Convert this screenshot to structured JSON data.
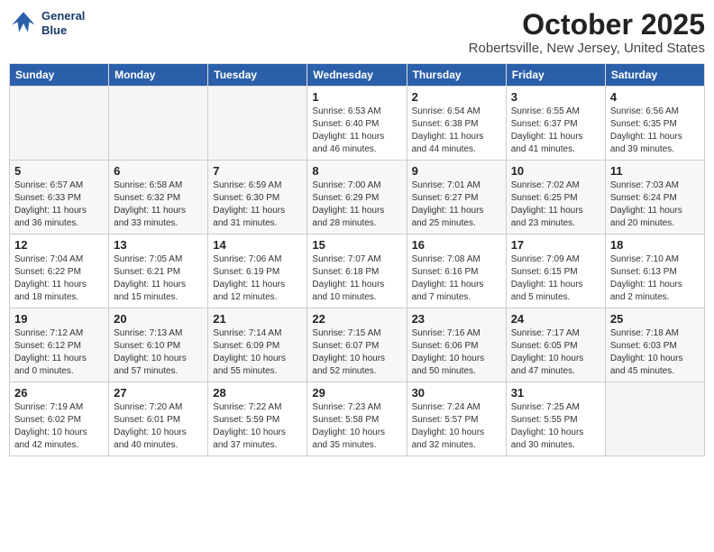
{
  "header": {
    "logo_line1": "General",
    "logo_line2": "Blue",
    "month": "October 2025",
    "location": "Robertsville, New Jersey, United States"
  },
  "weekdays": [
    "Sunday",
    "Monday",
    "Tuesday",
    "Wednesday",
    "Thursday",
    "Friday",
    "Saturday"
  ],
  "weeks": [
    [
      {
        "day": "",
        "info": ""
      },
      {
        "day": "",
        "info": ""
      },
      {
        "day": "",
        "info": ""
      },
      {
        "day": "1",
        "info": "Sunrise: 6:53 AM\nSunset: 6:40 PM\nDaylight: 11 hours\nand 46 minutes."
      },
      {
        "day": "2",
        "info": "Sunrise: 6:54 AM\nSunset: 6:38 PM\nDaylight: 11 hours\nand 44 minutes."
      },
      {
        "day": "3",
        "info": "Sunrise: 6:55 AM\nSunset: 6:37 PM\nDaylight: 11 hours\nand 41 minutes."
      },
      {
        "day": "4",
        "info": "Sunrise: 6:56 AM\nSunset: 6:35 PM\nDaylight: 11 hours\nand 39 minutes."
      }
    ],
    [
      {
        "day": "5",
        "info": "Sunrise: 6:57 AM\nSunset: 6:33 PM\nDaylight: 11 hours\nand 36 minutes."
      },
      {
        "day": "6",
        "info": "Sunrise: 6:58 AM\nSunset: 6:32 PM\nDaylight: 11 hours\nand 33 minutes."
      },
      {
        "day": "7",
        "info": "Sunrise: 6:59 AM\nSunset: 6:30 PM\nDaylight: 11 hours\nand 31 minutes."
      },
      {
        "day": "8",
        "info": "Sunrise: 7:00 AM\nSunset: 6:29 PM\nDaylight: 11 hours\nand 28 minutes."
      },
      {
        "day": "9",
        "info": "Sunrise: 7:01 AM\nSunset: 6:27 PM\nDaylight: 11 hours\nand 25 minutes."
      },
      {
        "day": "10",
        "info": "Sunrise: 7:02 AM\nSunset: 6:25 PM\nDaylight: 11 hours\nand 23 minutes."
      },
      {
        "day": "11",
        "info": "Sunrise: 7:03 AM\nSunset: 6:24 PM\nDaylight: 11 hours\nand 20 minutes."
      }
    ],
    [
      {
        "day": "12",
        "info": "Sunrise: 7:04 AM\nSunset: 6:22 PM\nDaylight: 11 hours\nand 18 minutes."
      },
      {
        "day": "13",
        "info": "Sunrise: 7:05 AM\nSunset: 6:21 PM\nDaylight: 11 hours\nand 15 minutes."
      },
      {
        "day": "14",
        "info": "Sunrise: 7:06 AM\nSunset: 6:19 PM\nDaylight: 11 hours\nand 12 minutes."
      },
      {
        "day": "15",
        "info": "Sunrise: 7:07 AM\nSunset: 6:18 PM\nDaylight: 11 hours\nand 10 minutes."
      },
      {
        "day": "16",
        "info": "Sunrise: 7:08 AM\nSunset: 6:16 PM\nDaylight: 11 hours\nand 7 minutes."
      },
      {
        "day": "17",
        "info": "Sunrise: 7:09 AM\nSunset: 6:15 PM\nDaylight: 11 hours\nand 5 minutes."
      },
      {
        "day": "18",
        "info": "Sunrise: 7:10 AM\nSunset: 6:13 PM\nDaylight: 11 hours\nand 2 minutes."
      }
    ],
    [
      {
        "day": "19",
        "info": "Sunrise: 7:12 AM\nSunset: 6:12 PM\nDaylight: 11 hours\nand 0 minutes."
      },
      {
        "day": "20",
        "info": "Sunrise: 7:13 AM\nSunset: 6:10 PM\nDaylight: 10 hours\nand 57 minutes."
      },
      {
        "day": "21",
        "info": "Sunrise: 7:14 AM\nSunset: 6:09 PM\nDaylight: 10 hours\nand 55 minutes."
      },
      {
        "day": "22",
        "info": "Sunrise: 7:15 AM\nSunset: 6:07 PM\nDaylight: 10 hours\nand 52 minutes."
      },
      {
        "day": "23",
        "info": "Sunrise: 7:16 AM\nSunset: 6:06 PM\nDaylight: 10 hours\nand 50 minutes."
      },
      {
        "day": "24",
        "info": "Sunrise: 7:17 AM\nSunset: 6:05 PM\nDaylight: 10 hours\nand 47 minutes."
      },
      {
        "day": "25",
        "info": "Sunrise: 7:18 AM\nSunset: 6:03 PM\nDaylight: 10 hours\nand 45 minutes."
      }
    ],
    [
      {
        "day": "26",
        "info": "Sunrise: 7:19 AM\nSunset: 6:02 PM\nDaylight: 10 hours\nand 42 minutes."
      },
      {
        "day": "27",
        "info": "Sunrise: 7:20 AM\nSunset: 6:01 PM\nDaylight: 10 hours\nand 40 minutes."
      },
      {
        "day": "28",
        "info": "Sunrise: 7:22 AM\nSunset: 5:59 PM\nDaylight: 10 hours\nand 37 minutes."
      },
      {
        "day": "29",
        "info": "Sunrise: 7:23 AM\nSunset: 5:58 PM\nDaylight: 10 hours\nand 35 minutes."
      },
      {
        "day": "30",
        "info": "Sunrise: 7:24 AM\nSunset: 5:57 PM\nDaylight: 10 hours\nand 32 minutes."
      },
      {
        "day": "31",
        "info": "Sunrise: 7:25 AM\nSunset: 5:55 PM\nDaylight: 10 hours\nand 30 minutes."
      },
      {
        "day": "",
        "info": ""
      }
    ]
  ]
}
